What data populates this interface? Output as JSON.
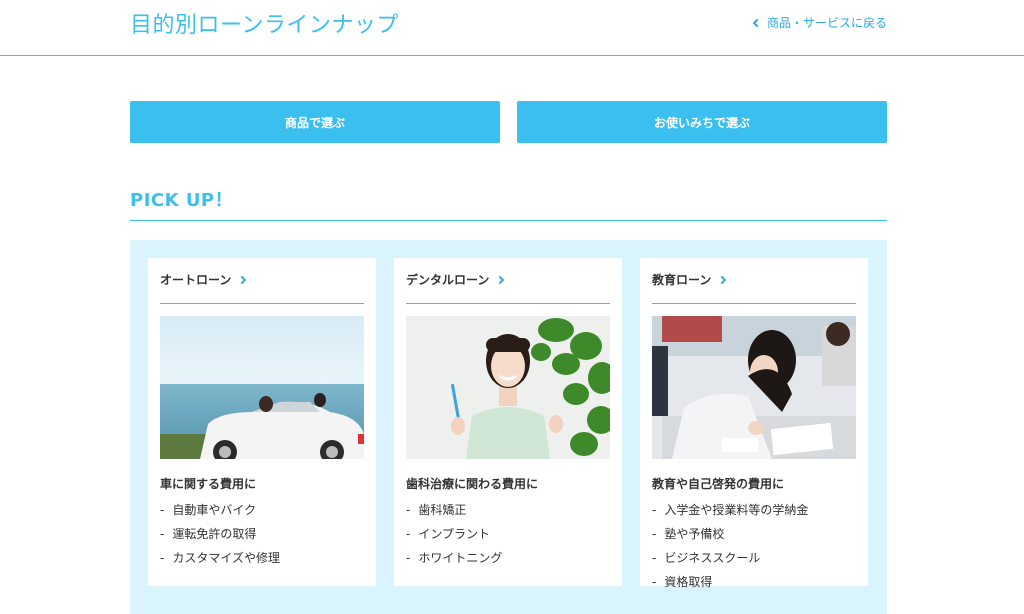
{
  "header": {
    "title": "目的別ローンラインナップ",
    "back_link": "商品・サービスに戻る"
  },
  "buttons": {
    "by_product": "商品で選ぶ",
    "by_purpose": "お使いみちで選ぶ"
  },
  "pickup": {
    "title": "PICK UP！"
  },
  "cards": [
    {
      "title": "オートローン",
      "subtitle": "車に関する費用に",
      "items": [
        "自動車やバイク",
        "運転免許の取得",
        "カスタマイズや修理"
      ]
    },
    {
      "title": "デンタルローン",
      "subtitle": "歯科治療に関わる費用に",
      "items": [
        "歯科矯正",
        "インプラント",
        "ホワイトニング"
      ]
    },
    {
      "title": "教育ローン",
      "subtitle": "教育や自己啓発の費用に",
      "items": [
        "入学金や授業料等の学納金",
        "塾や予備校",
        "ビジネススクール",
        "資格取得"
      ]
    }
  ],
  "colors": {
    "accent": "#3bbfee",
    "panel_bg": "#d9f4fd",
    "link": "#2aa9dc"
  },
  "icons": {
    "back": "chevron-left-icon",
    "card_link": "chevron-right-icon"
  }
}
